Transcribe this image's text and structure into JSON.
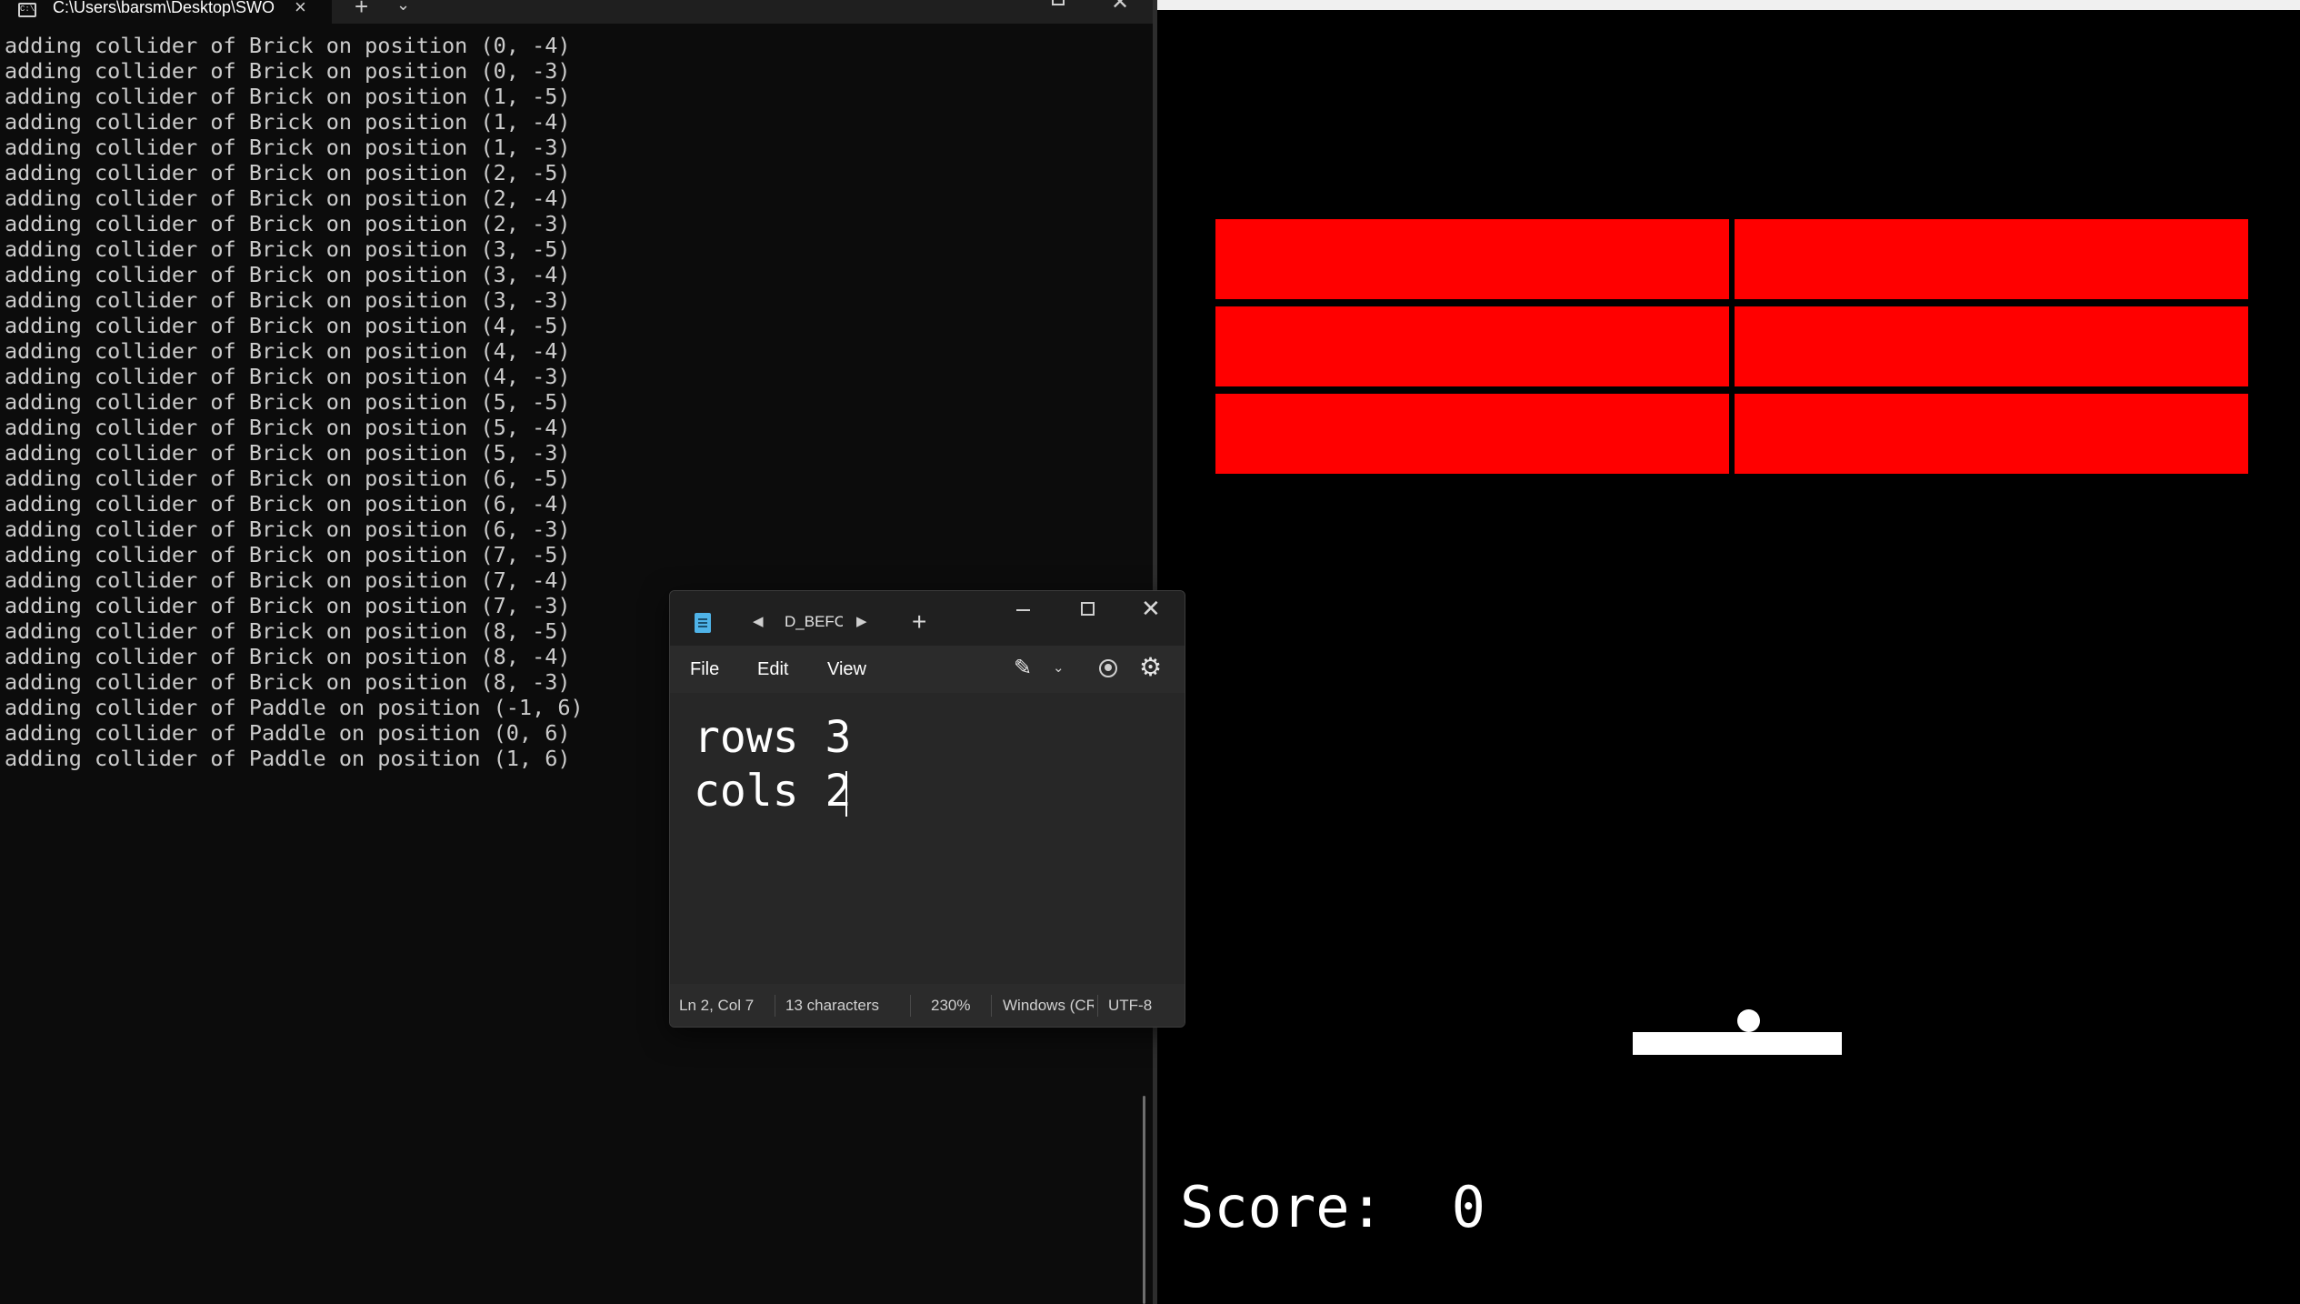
{
  "terminal": {
    "tab_icon": "terminal-icon",
    "tab_title": "C:\\Users\\barsm\\Desktop\\SWO",
    "output_lines": [
      "adding collider of Brick on position (0, -4)",
      "adding collider of Brick on position (0, -3)",
      "adding collider of Brick on position (1, -5)",
      "adding collider of Brick on position (1, -4)",
      "adding collider of Brick on position (1, -3)",
      "adding collider of Brick on position (2, -5)",
      "adding collider of Brick on position (2, -4)",
      "adding collider of Brick on position (2, -3)",
      "adding collider of Brick on position (3, -5)",
      "adding collider of Brick on position (3, -4)",
      "adding collider of Brick on position (3, -3)",
      "adding collider of Brick on position (4, -5)",
      "adding collider of Brick on position (4, -4)",
      "adding collider of Brick on position (4, -3)",
      "adding collider of Brick on position (5, -5)",
      "adding collider of Brick on position (5, -4)",
      "adding collider of Brick on position (5, -3)",
      "adding collider of Brick on position (6, -5)",
      "adding collider of Brick on position (6, -4)",
      "adding collider of Brick on position (6, -3)",
      "adding collider of Brick on position (7, -5)",
      "adding collider of Brick on position (7, -4)",
      "adding collider of Brick on position (7, -3)",
      "adding collider of Brick on position (8, -5)",
      "adding collider of Brick on position (8, -4)",
      "adding collider of Brick on position (8, -3)",
      "adding collider of Paddle on position (-1, 6)",
      "adding collider of Paddle on position (0, 6)",
      "adding collider of Paddle on position (1, 6)"
    ],
    "colors": {
      "background": "#0c0c0c",
      "text": "#cccccc"
    }
  },
  "notepad": {
    "app_icon": "notepad-icon",
    "tab_title": "D_BEFC",
    "menu": {
      "file": "File",
      "edit": "Edit",
      "view": "View"
    },
    "icons": [
      "copilot-pen-icon",
      "chevron-down-icon",
      "account-icon",
      "gear-icon"
    ],
    "content": "rows 3\ncols 2",
    "status": {
      "position": "Ln 2, Col 7",
      "characters": "13 characters",
      "zoom": "230%",
      "line_ending": "Windows (CRLF)",
      "encoding": "UTF-8"
    }
  },
  "game": {
    "score_text": "Score:  0",
    "brick_grid": {
      "rows": 3,
      "cols": 2
    },
    "colors": {
      "brick": "#ff0000",
      "paddle": "#ffffff",
      "ball": "#ffffff",
      "background": "#000000"
    }
  }
}
